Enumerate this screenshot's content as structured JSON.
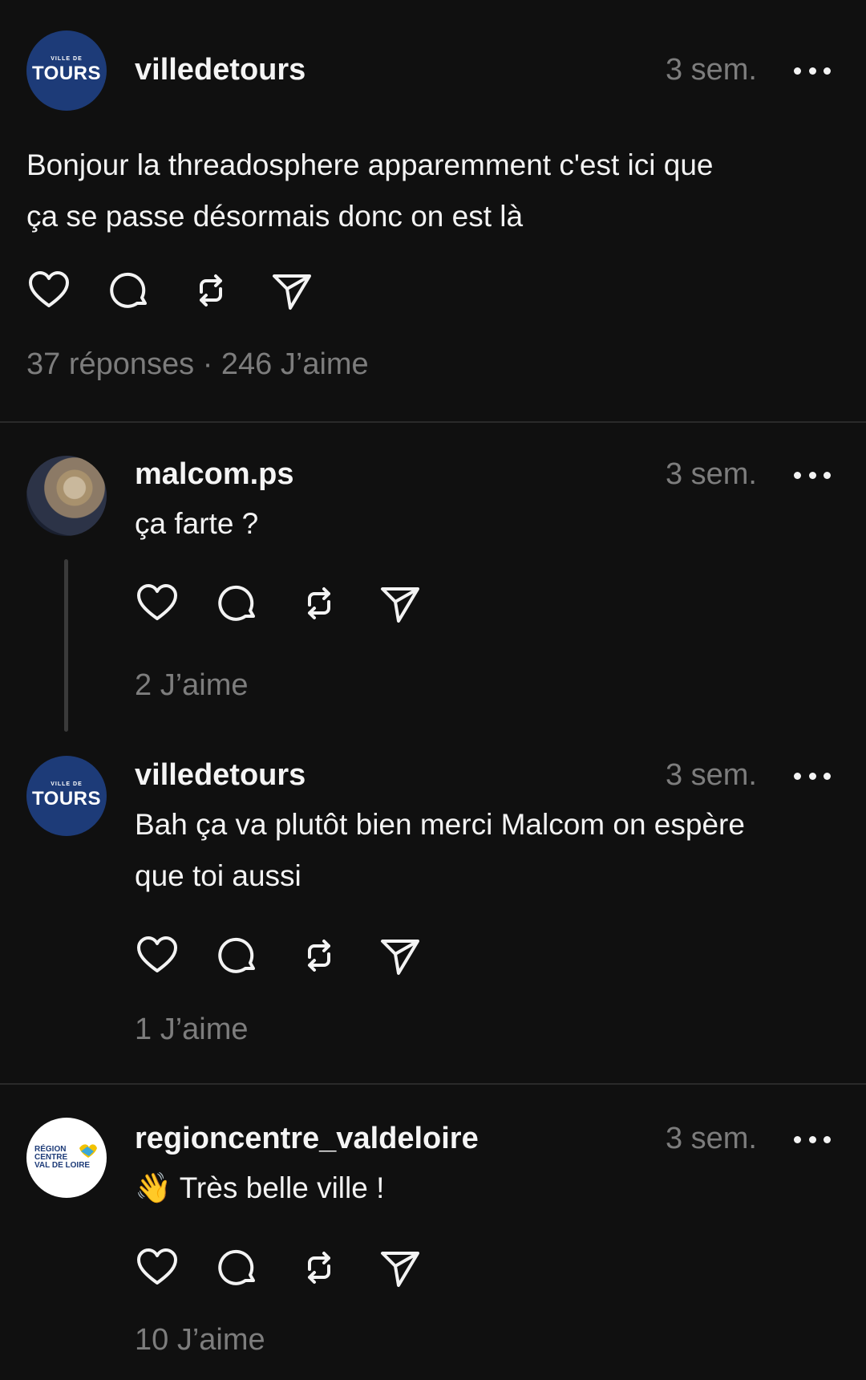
{
  "posts": [
    {
      "username": "villedetours",
      "time": "3 sem.",
      "avatar_text": {
        "small": "VILLE DE",
        "big": "TOURS"
      },
      "text_lines": [
        "Bonjour la threadosphere apparemment c'est ici que",
        "ça se passe désormais donc on est là"
      ],
      "stats": "37 réponses · 246 J’aime"
    },
    {
      "username": "malcom.ps",
      "time": "3 sem.",
      "text_lines": [
        "ça farte ?"
      ],
      "stats": "2 J’aime"
    },
    {
      "username": "villedetours",
      "time": "3 sem.",
      "avatar_text": {
        "small": "VILLE DE",
        "big": "TOURS"
      },
      "text_lines": [
        "Bah ça va plutôt bien merci Malcom on espère",
        "que toi aussi"
      ],
      "stats": "1 J’aime"
    },
    {
      "username": "regioncentre_valdeloire",
      "time": "3 sem.",
      "avatar_text": {
        "l1": "RÉGION",
        "l2": "CENTRE",
        "l3": "VAL DE LOIRE"
      },
      "emoji": "👋",
      "text_lines": [
        "Très belle ville !"
      ],
      "stats": "10 J’aime"
    }
  ],
  "icons": [
    "heart-icon",
    "comment-icon",
    "repost-icon",
    "share-icon",
    "more-icon"
  ],
  "colors": {
    "background": "#101010",
    "muted": "#7d7d7d",
    "tours_blue": "#1d3b78"
  }
}
